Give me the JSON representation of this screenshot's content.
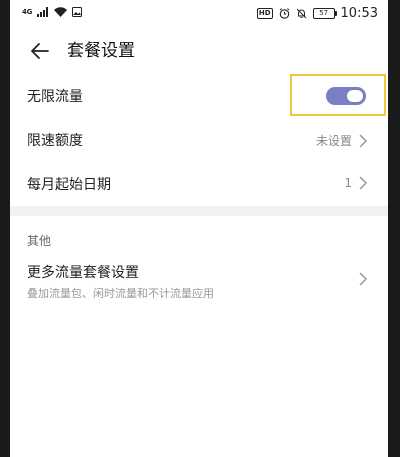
{
  "status_bar": {
    "network": "4G",
    "hd": "HD",
    "battery": "57",
    "time": "10:53"
  },
  "header": {
    "title": "套餐设置"
  },
  "settings": {
    "unlimited": {
      "label": "无限流量",
      "enabled": true
    },
    "speed_limit": {
      "label": "限速额度",
      "value": "未设置"
    },
    "start_date": {
      "label": "每月起始日期",
      "value": "1"
    }
  },
  "other": {
    "section_title": "其他",
    "more_plans": {
      "title": "更多流量套餐设置",
      "subtitle": "叠加流量包、闲时流量和不计流量应用"
    }
  },
  "colors": {
    "toggle_on": "#7b7fc2",
    "highlight": "#f3c73a"
  }
}
